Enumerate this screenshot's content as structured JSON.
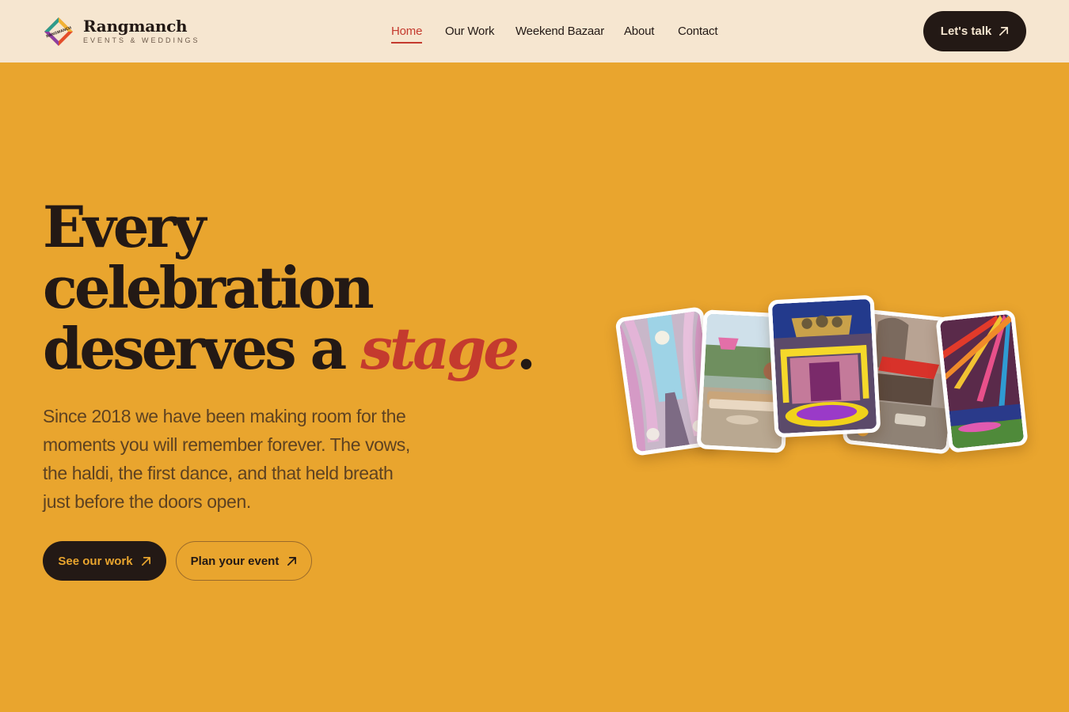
{
  "brand": {
    "name": "Rangmanch",
    "tagline": "EVENTS & WEDDINGS",
    "mark_text": "RANGMANCH",
    "colors": {
      "accent": "#C43A2E",
      "background": "#E9A52E",
      "header": "#F6E6D0",
      "dark": "#231915"
    }
  },
  "nav": {
    "items": [
      {
        "label": "Home",
        "active": true
      },
      {
        "label": "Our Work",
        "active": false
      },
      {
        "label": "Weekend Bazaar",
        "active": false
      },
      {
        "label": "About",
        "active": false
      },
      {
        "label": "Contact",
        "active": false
      }
    ],
    "cta_label": "Let's talk",
    "cta_icon": "arrow-up-right-icon"
  },
  "hero": {
    "headline_line1": "Every",
    "headline_line2": "celebration",
    "headline_line3_prefix": "deserves a ",
    "headline_accent": "stage",
    "headline_period": ".",
    "lede": "Since 2018 we have been making room for the moments you will remember forever. The vows, the haldi, the first dance, and that held breath just before the doors open.",
    "primary_button": "See our work",
    "secondary_button": "Plan your event",
    "button_icon": "arrow-up-right-icon"
  },
  "gallery": {
    "photos": [
      {
        "name": "photo-pastel-drape-aisle"
      },
      {
        "name": "photo-garden-lounge-seating"
      },
      {
        "name": "photo-marigold-mandap-stage"
      },
      {
        "name": "photo-red-canopy-courtyard"
      },
      {
        "name": "photo-colorful-streamers-tent"
      }
    ]
  }
}
